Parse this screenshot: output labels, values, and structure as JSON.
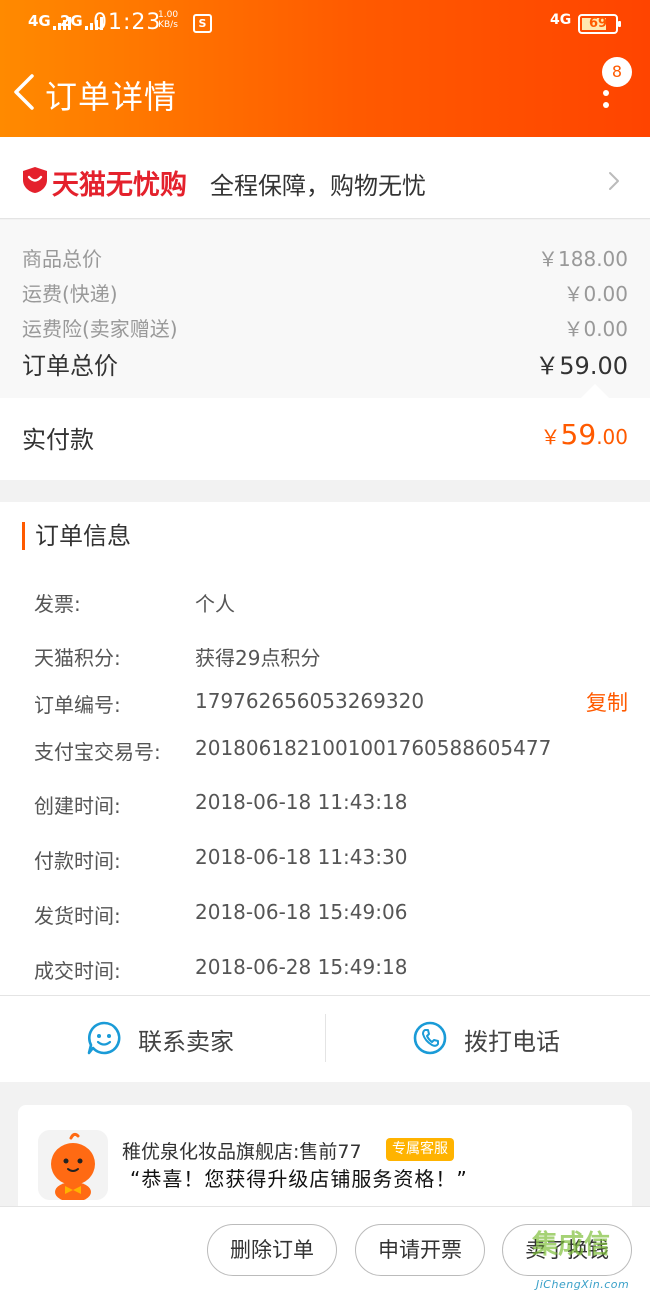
{
  "status_bar": {
    "net1": "4G",
    "net2": "2G",
    "time": "01:23",
    "speed_value": "1.00",
    "speed_unit": "KB/s",
    "sim_icon": "S",
    "net_right": "4G",
    "battery": "69"
  },
  "header": {
    "title": "订单详情",
    "badge_count": "8",
    "bg_start": "#ff8a00",
    "bg_end": "#ff4400"
  },
  "guarantee": {
    "brand": "天猫无忧购",
    "slogan": "全程保障，购物无忧"
  },
  "prices": {
    "rows": [
      {
        "label": "商品总价",
        "value": "￥188.00"
      },
      {
        "label": "运费(快递)",
        "value": "￥0.00"
      },
      {
        "label": "运费险(卖家赠送)",
        "value": "￥0.00"
      }
    ],
    "total_label": "订单总价",
    "total_value": "￥59.00",
    "paid_label": "实付款",
    "paid_symbol": "￥",
    "paid_integer": "59",
    "paid_decimal": ".00"
  },
  "order_info": {
    "title": "订单信息",
    "rows": [
      {
        "key": "发票:",
        "value": "个人"
      },
      {
        "key": "天猫积分:",
        "value": "获得29点积分"
      },
      {
        "key": "订单编号:",
        "value": "179762656053269320"
      },
      {
        "key": "支付宝交易号:",
        "value": "2018061821001001760588605477"
      },
      {
        "key": "创建时间:",
        "value": "2018-06-18 11:43:18"
      },
      {
        "key": "付款时间:",
        "value": "2018-06-18 11:43:30"
      },
      {
        "key": "发货时间:",
        "value": "2018-06-18 15:49:06"
      },
      {
        "key": "成交时间:",
        "value": "2018-06-28 15:49:18"
      }
    ],
    "copy_label": "复制"
  },
  "contact": {
    "seller_label": "联系卖家",
    "phone_label": "拨打电话"
  },
  "chat": {
    "shop_line": "稚优泉化妆品旗舰店:售前77",
    "tag": "专属客服",
    "message": "“恭喜！您获得升级店铺服务资格！”"
  },
  "actions": {
    "delete": "删除订单",
    "invoice": "申请开票",
    "resell": "卖了换钱"
  },
  "watermark": {
    "mark": "集成信",
    "url": "JiChengXin.com"
  },
  "accent_color": "#ff5a00"
}
